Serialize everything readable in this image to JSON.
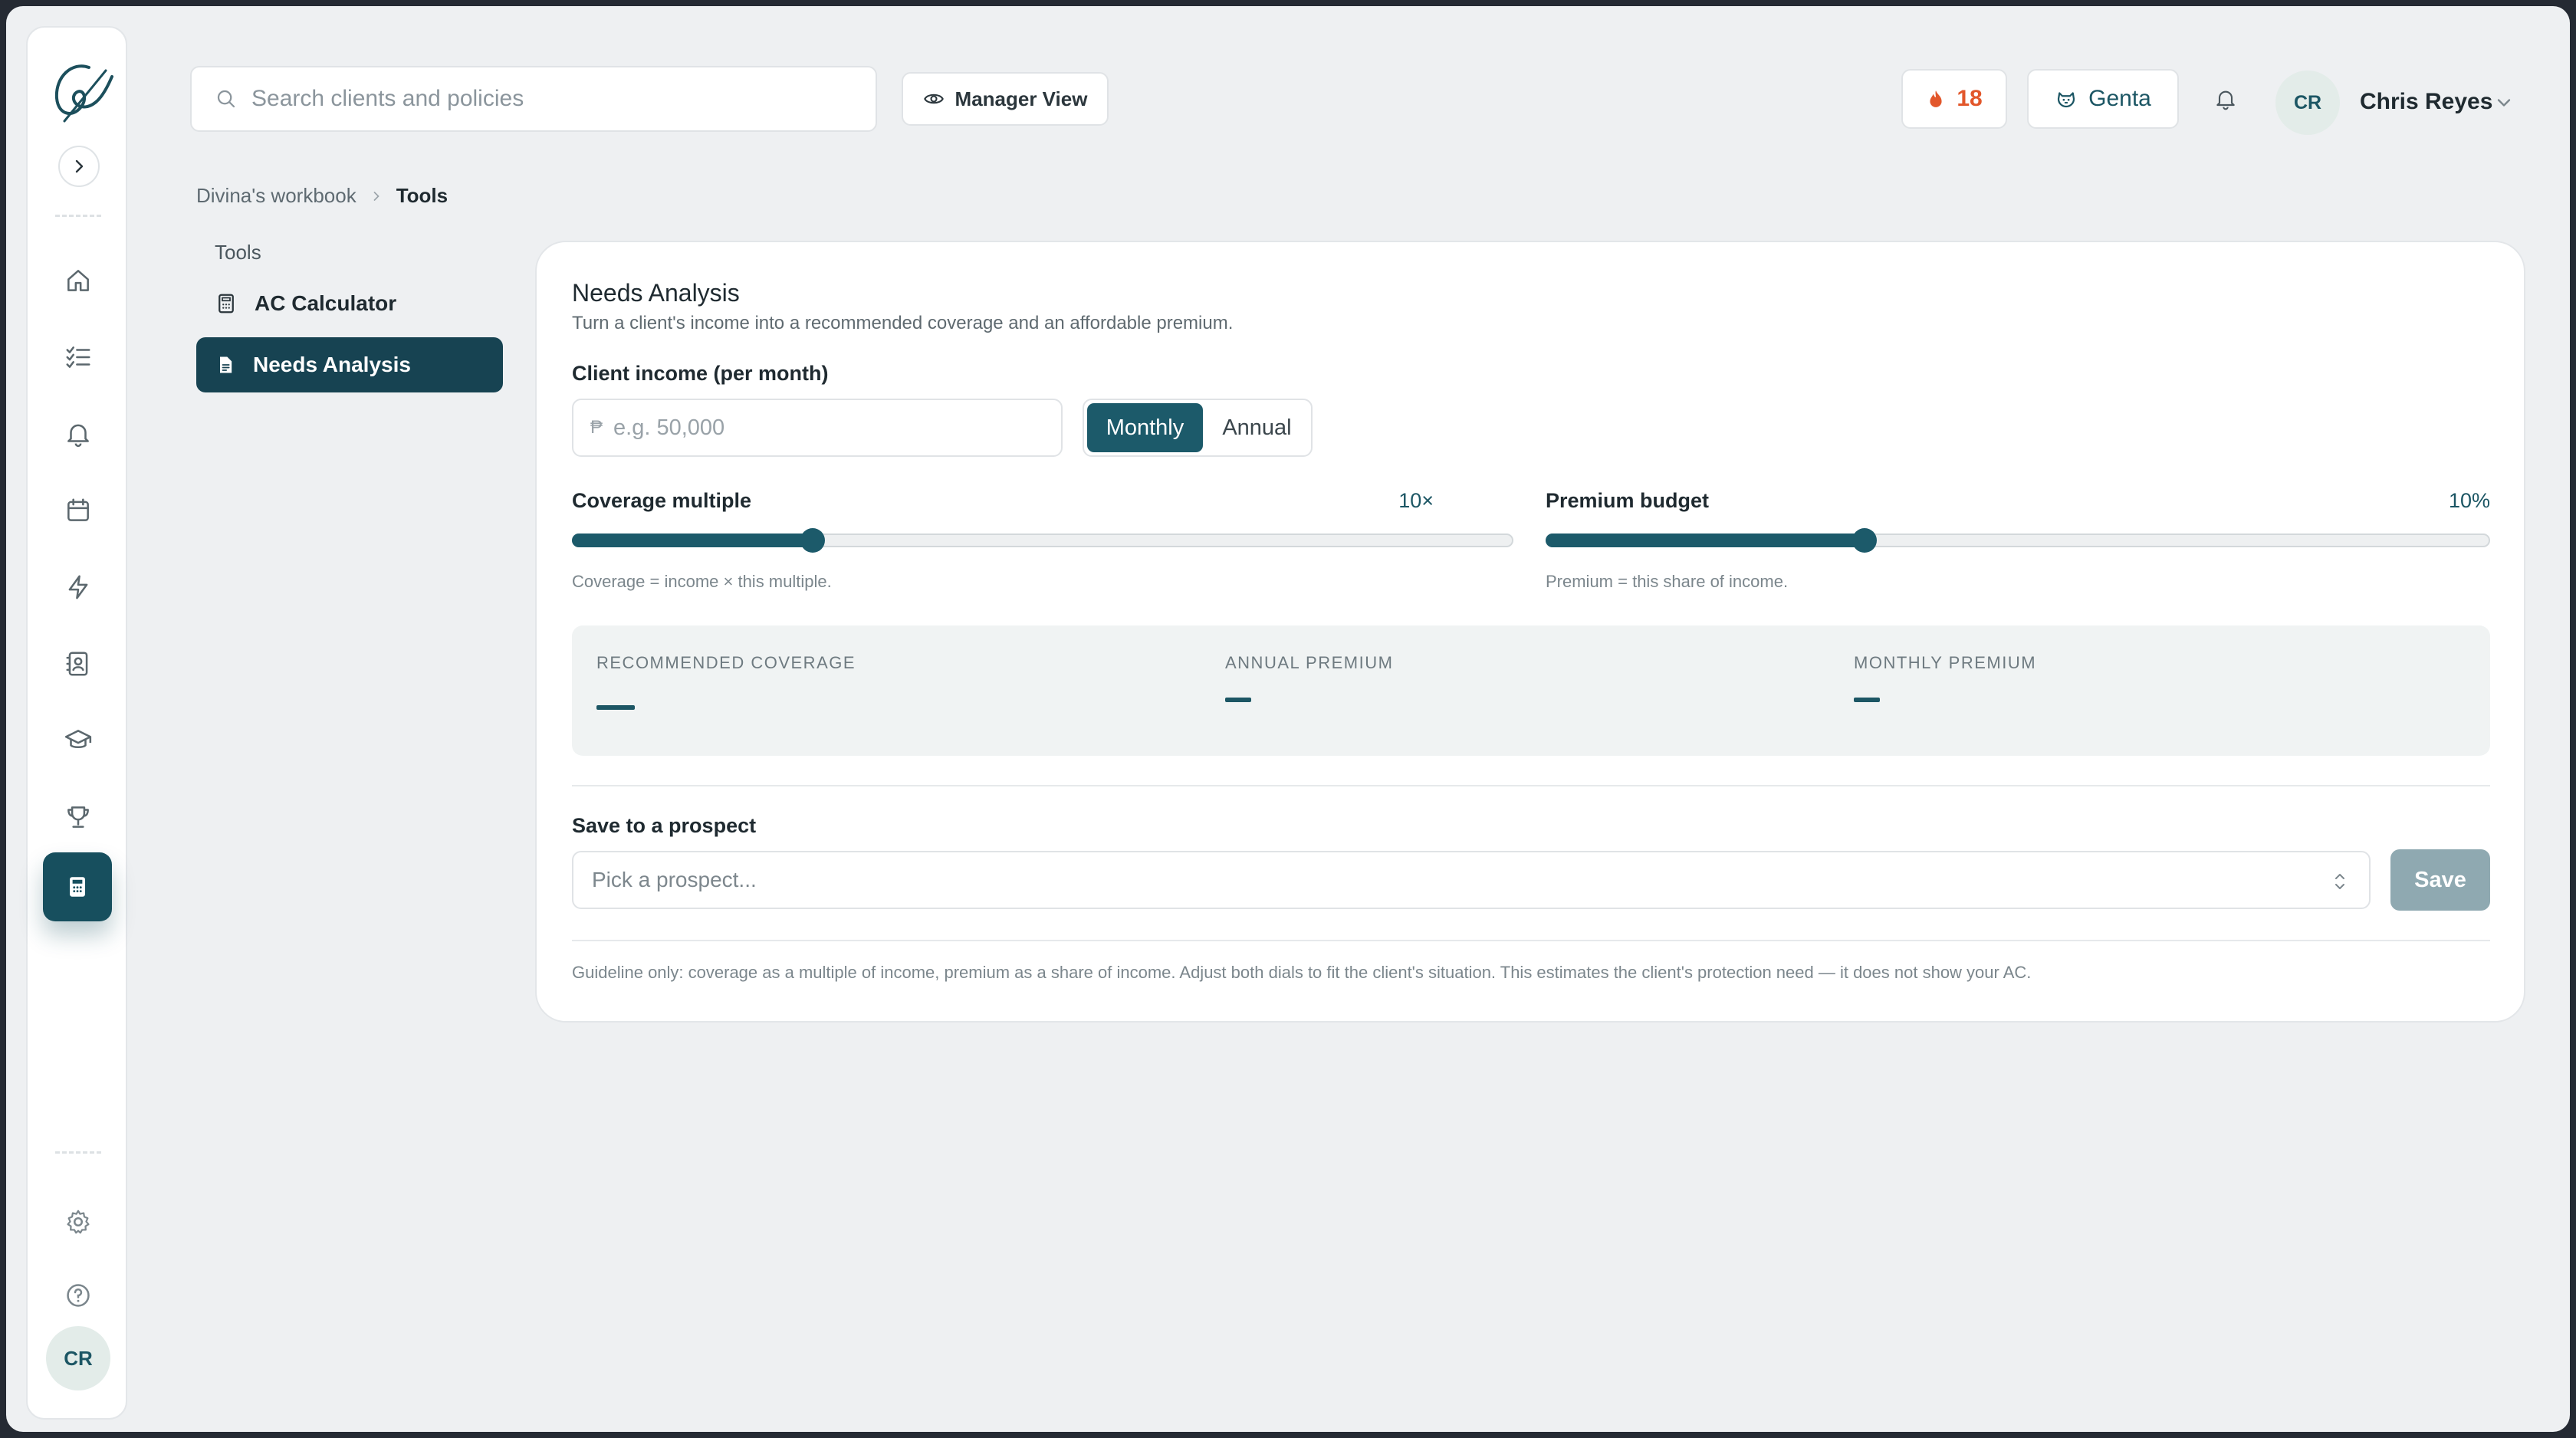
{
  "search": {
    "placeholder": "Search clients and policies"
  },
  "header": {
    "manager_view_label": "Manager View",
    "streak_count": "18",
    "mascot_label": "Genta",
    "user_initials": "CR",
    "user_name": "Chris Reyes"
  },
  "rail": {
    "avatar_initials": "CR",
    "items": [
      "home-icon",
      "checklist-icon",
      "bell-icon",
      "calendar-icon",
      "lightning-icon",
      "contacts-icon",
      "graduation-cap-icon",
      "trophy-icon",
      "calculator-icon"
    ],
    "active_item": "calculator-icon"
  },
  "breadcrumb": {
    "parent": "Divina's workbook",
    "current": "Tools"
  },
  "tools": {
    "heading": "Tools",
    "items": [
      {
        "label": "AC Calculator",
        "icon": "calculator-icon",
        "active": false
      },
      {
        "label": "Needs Analysis",
        "icon": "document-icon",
        "active": true
      }
    ]
  },
  "needs": {
    "title": "Needs Analysis",
    "subtitle": "Turn a client's income into a recommended coverage and an affordable premium.",
    "income_label": "Client income (per month)",
    "currency_symbol": "₱",
    "income_placeholder": "e.g. 50,000",
    "period_options": [
      "Monthly",
      "Annual"
    ],
    "period_selected": "Monthly",
    "coverage": {
      "label": "Coverage multiple",
      "value_text": "10×",
      "fraction": 0.255,
      "hint": "Coverage = income × this multiple."
    },
    "premium": {
      "label": "Premium budget",
      "value_text": "10%",
      "fraction": 0.337,
      "hint": "Premium = this share of income."
    },
    "results": [
      {
        "label": "RECOMMENDED COVERAGE",
        "value": "—"
      },
      {
        "label": "ANNUAL PREMIUM",
        "value": "—"
      },
      {
        "label": "MONTHLY PREMIUM",
        "value": "—"
      }
    ],
    "save_label": "Save to a prospect",
    "prospect_placeholder": "Pick a prospect...",
    "save_button": "Save",
    "footnote": "Guideline only: coverage as a multiple of income, premium as a share of income. Adjust both dials to fit the client's situation. This estimates the client's protection need — it does not show your AC."
  },
  "colors": {
    "accent": "#174f5e",
    "streak": "#e2572b",
    "save_disabled": "#8fa9b1"
  }
}
